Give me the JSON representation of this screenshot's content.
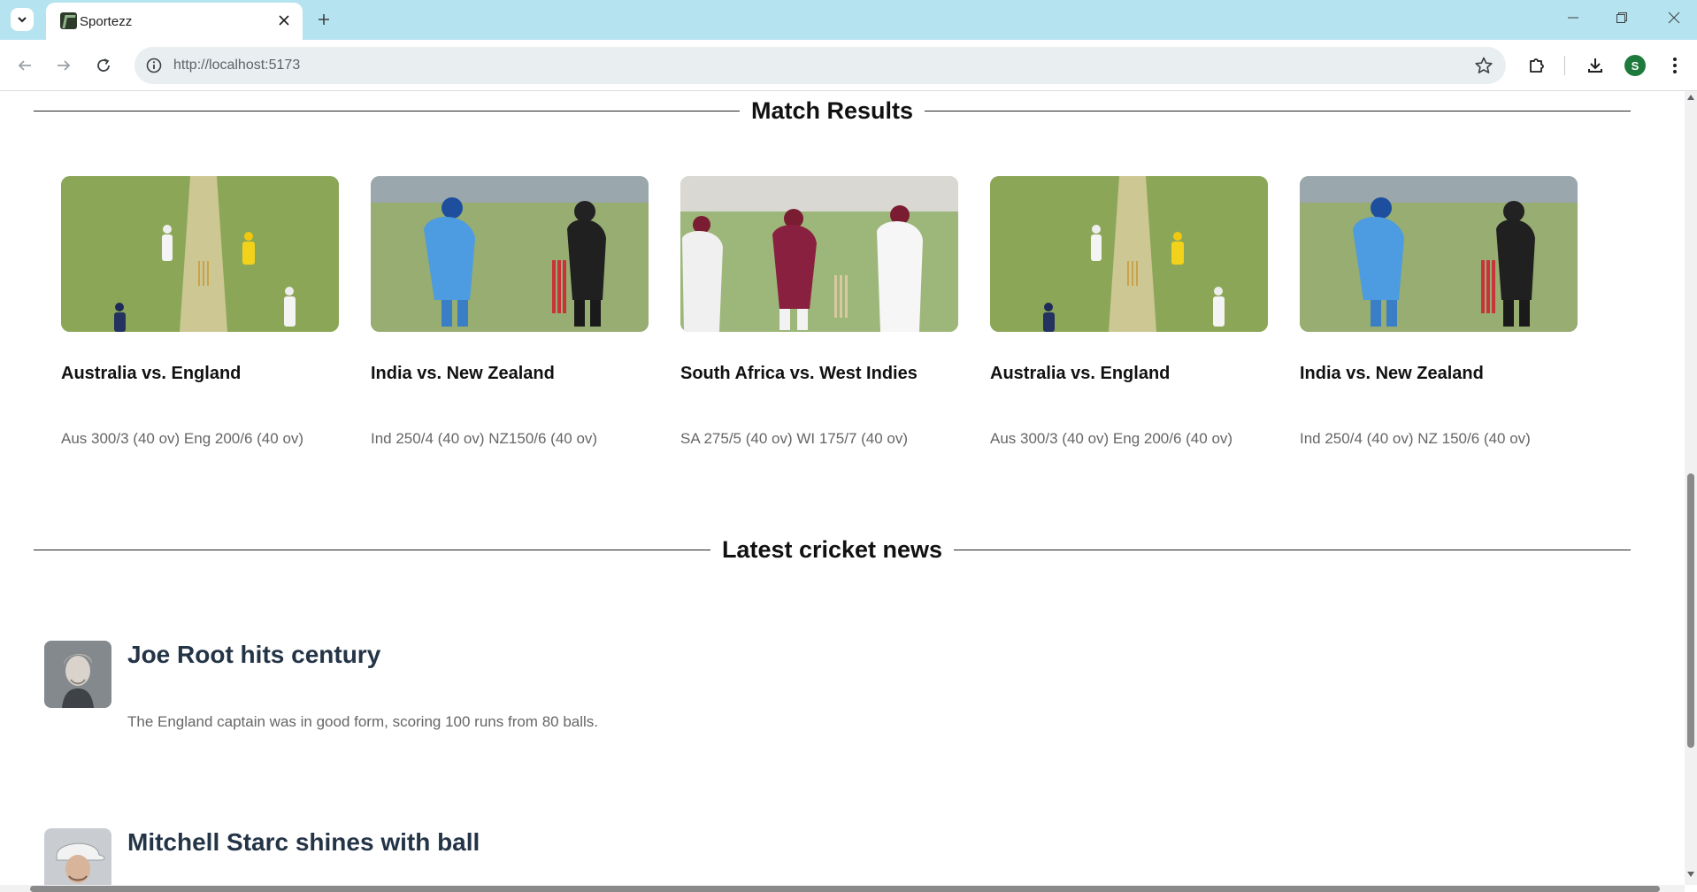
{
  "browser": {
    "tab_title": "Sportezz",
    "url": "http://localhost:5173",
    "profile_initial": "S"
  },
  "page": {
    "match_results_heading": "Match Results",
    "matches": [
      {
        "title": "Australia vs. England",
        "score": "Aus 300/3 (40 ov) Eng 200/6 (40 ov)",
        "image": "cricket-aus-eng"
      },
      {
        "title": "India vs. New Zealand",
        "score": "Ind 250/4 (40 ov) NZ150/6 (40 ov)",
        "image": "cricket-ind-nz"
      },
      {
        "title": "South Africa vs. West Indies",
        "score": "SA 275/5 (40 ov) WI 175/7 (40 ov)",
        "image": "cricket-sa-wi"
      },
      {
        "title": "Australia vs. England",
        "score": "Aus 300/3 (40 ov) Eng 200/6 (40 ov)",
        "image": "cricket-aus-eng"
      },
      {
        "title": "India vs. New Zealand",
        "score": "Ind 250/4 (40 ov) NZ 150/6 (40 ov)",
        "image": "cricket-ind-nz"
      }
    ],
    "news_heading": "Latest cricket news",
    "news": [
      {
        "title": "Joe Root hits century",
        "body": "The England captain was in good form, scoring 100 runs from 80 balls.",
        "image": "player-portrait"
      },
      {
        "title": "Mitchell Starc shines with ball",
        "body": "",
        "image": "player-portrait-cap"
      }
    ]
  },
  "colors": {
    "tabstrip_bg": "#b6e3f0",
    "heading_text": "#111111",
    "news_title": "#243447",
    "muted_text": "#666666"
  }
}
